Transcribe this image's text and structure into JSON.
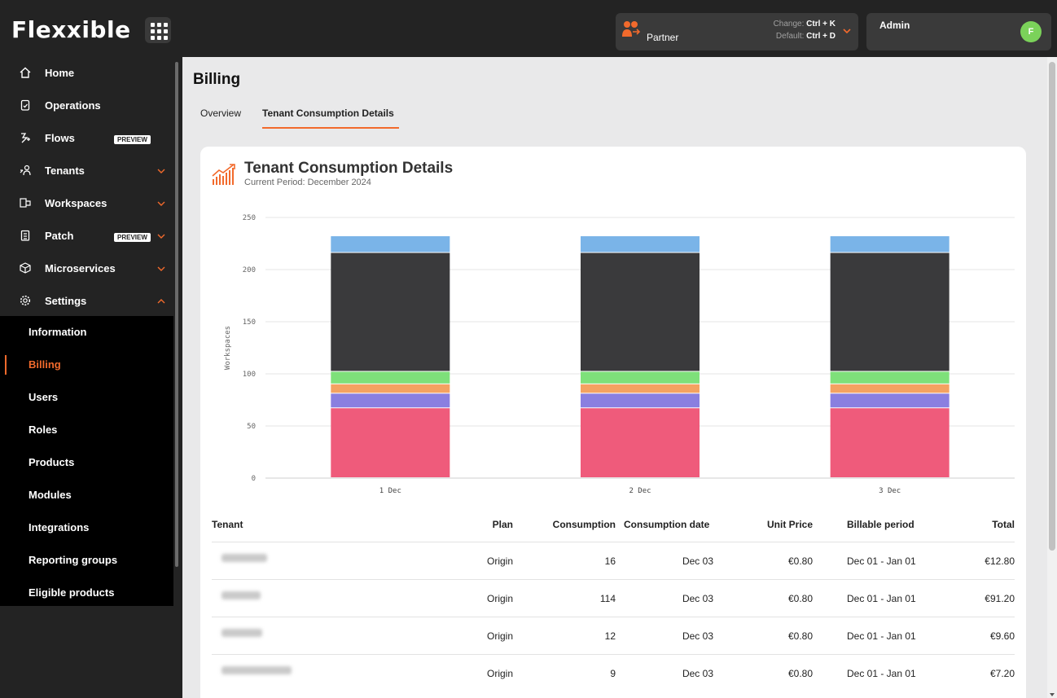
{
  "topbar": {
    "logo": "Flexxible",
    "apps_icon": "grid-icon",
    "partner": {
      "label": "Partner",
      "change_label": "Change:",
      "change_key": "Ctrl + K",
      "default_label": "Default:",
      "default_key": "Ctrl + D"
    },
    "user": {
      "name": "Admin",
      "avatar_initial": "F",
      "avatar_color": "#7bd25a"
    }
  },
  "sidebar": {
    "items": [
      {
        "label": "Home",
        "icon": "home-icon"
      },
      {
        "label": "Operations",
        "icon": "clipboard-icon"
      },
      {
        "label": "Flows",
        "icon": "flows-icon",
        "badge": "PREVIEW"
      },
      {
        "label": "Tenants",
        "icon": "tenants-icon"
      },
      {
        "label": "Workspaces",
        "icon": "workspaces-icon"
      },
      {
        "label": "Patch",
        "icon": "patch-icon",
        "badge": "PREVIEW"
      },
      {
        "label": "Microservices",
        "icon": "cube-icon"
      },
      {
        "label": "Settings",
        "icon": "gear-icon"
      }
    ],
    "settings_sub": [
      {
        "label": "Information"
      },
      {
        "label": "Billing"
      },
      {
        "label": "Users"
      },
      {
        "label": "Roles"
      },
      {
        "label": "Products"
      },
      {
        "label": "Modules"
      },
      {
        "label": "Integrations"
      },
      {
        "label": "Reporting groups"
      },
      {
        "label": "Eligible products"
      }
    ]
  },
  "page": {
    "title": "Billing",
    "tabs": [
      {
        "label": "Overview"
      },
      {
        "label": "Tenant Consumption Details"
      }
    ],
    "active_tab": "Tenant Consumption Details"
  },
  "card": {
    "title": "Tenant Consumption Details",
    "subtitle": "Current Period: December 2024"
  },
  "chart_data": {
    "type": "bar",
    "stacked": true,
    "categories": [
      "1 Dec",
      "2 Dec",
      "3 Dec"
    ],
    "ylabel": "Workspaces",
    "xlabel": "",
    "ylim": [
      0,
      250
    ],
    "yticks": [
      0,
      50,
      100,
      150,
      200,
      250
    ],
    "grid": true,
    "series": [
      {
        "values": [
          67,
          67,
          67
        ],
        "color": "#ef5b7b"
      },
      {
        "values": [
          14,
          14,
          14
        ],
        "color": "#8a7fe0"
      },
      {
        "values": [
          9,
          9,
          9
        ],
        "color": "#f4a261"
      },
      {
        "values": [
          12,
          12,
          12
        ],
        "color": "#7ee07a"
      },
      {
        "values": [
          114,
          114,
          114
        ],
        "color": "#3a3a3c"
      },
      {
        "values": [
          16,
          16,
          16
        ],
        "color": "#7ab4e8"
      }
    ]
  },
  "table": {
    "columns": [
      "Tenant",
      "Plan",
      "Consumption",
      "Consumption date",
      "Unit Price",
      "Billable period",
      "Total"
    ],
    "rows": [
      {
        "plan": "Origin",
        "consumption": "16",
        "date": "Dec 03",
        "unit_price": "€0.80",
        "period": "Dec 01 - Jan 01",
        "total": "€12.80"
      },
      {
        "plan": "Origin",
        "consumption": "114",
        "date": "Dec 03",
        "unit_price": "€0.80",
        "period": "Dec 01 - Jan 01",
        "total": "€91.20"
      },
      {
        "plan": "Origin",
        "consumption": "12",
        "date": "Dec 03",
        "unit_price": "€0.80",
        "period": "Dec 01 - Jan 01",
        "total": "€9.60"
      },
      {
        "plan": "Origin",
        "consumption": "9",
        "date": "Dec 03",
        "unit_price": "€0.80",
        "period": "Dec 01 - Jan 01",
        "total": "€7.20"
      }
    ]
  }
}
